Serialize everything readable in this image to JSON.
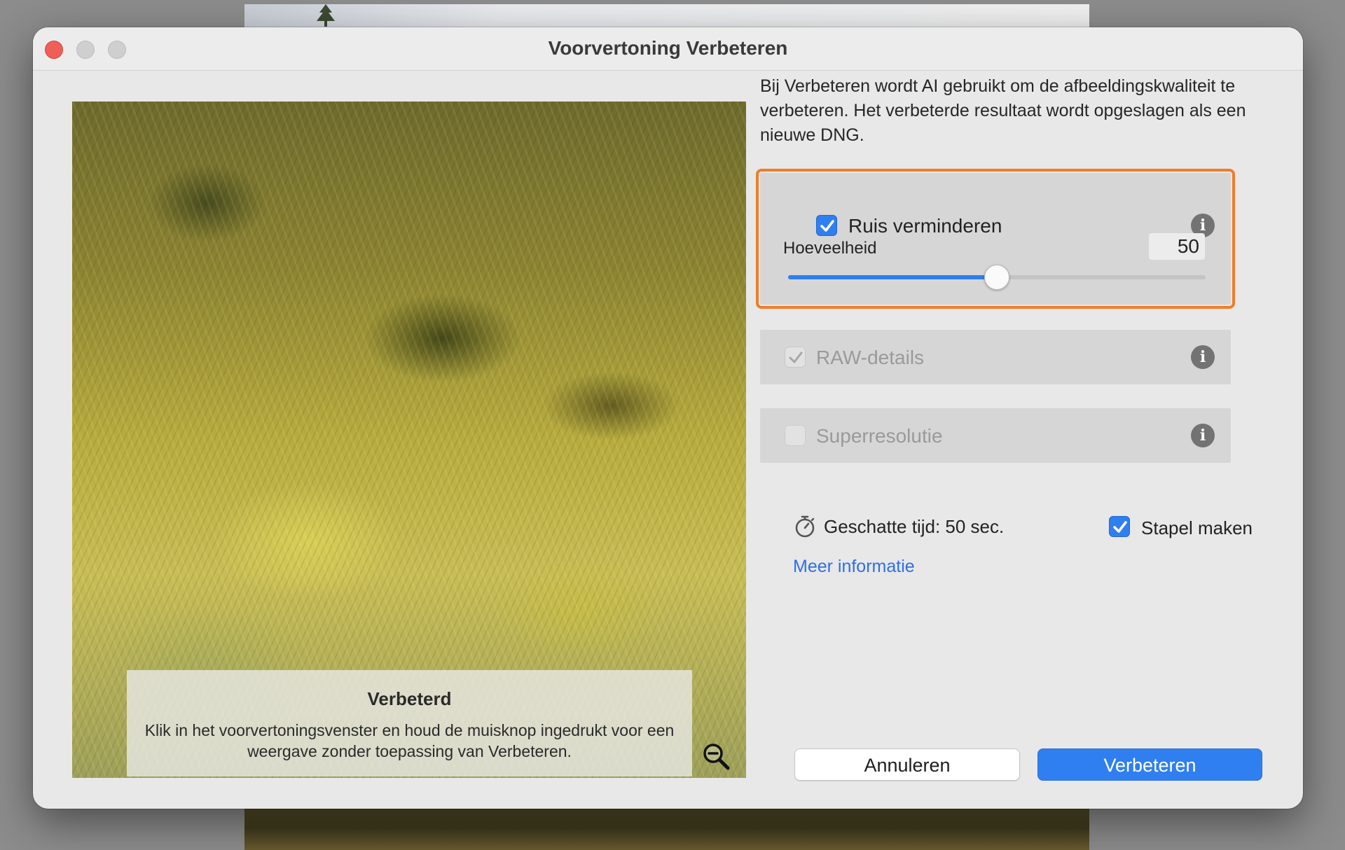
{
  "window": {
    "title": "Voorvertoning Verbeteren"
  },
  "preview": {
    "caption_title": "Verbeterd",
    "caption_text": "Klik in het voorvertoningsvenster en houd de muisknop ingedrukt voor een weergave zonder toepassing van Verbeteren.",
    "zoom_icon": "zoom-out-icon"
  },
  "panel": {
    "description": "Bij Verbeteren wordt AI gebruikt om de afbeeldingskwaliteit te verbeteren. Het verbeterde resultaat wordt opgeslagen als een nieuwe DNG.",
    "options": {
      "noise": {
        "label": "Ruis verminderen",
        "checked": true,
        "enabled": true,
        "amount_label": "Hoeveelheid",
        "amount_value": "50",
        "slider_fraction": 0.5
      },
      "raw": {
        "label": "RAW-details",
        "checked": true,
        "enabled": false
      },
      "super": {
        "label": "Superresolutie",
        "checked": false,
        "enabled": false
      }
    },
    "estimate": "Geschatte tijd: 50 sec.",
    "stack_label": "Stapel maken",
    "stack_checked": true,
    "more_info": "Meer informatie"
  },
  "buttons": {
    "cancel": "Annuleren",
    "enhance": "Verbeteren"
  },
  "colors": {
    "accent": "#2f7ff0",
    "highlight": "#f07d28",
    "close": "#ee5f57"
  }
}
